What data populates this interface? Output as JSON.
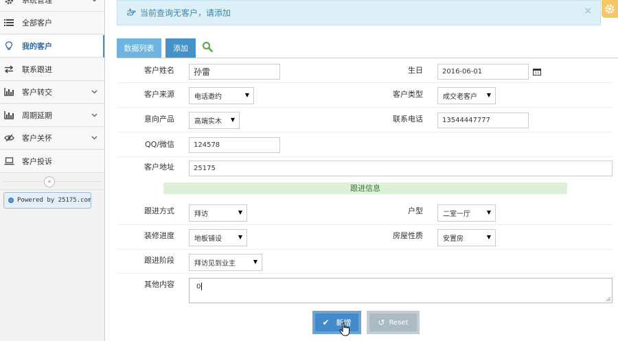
{
  "sidebar": {
    "items": [
      {
        "label": "系统管理",
        "icon": "gear-icon",
        "has_chevron": true
      },
      {
        "label": "全部客户",
        "icon": "list-icon",
        "has_chevron": false
      },
      {
        "label": "我的客户",
        "icon": "lightbulb-icon",
        "has_chevron": false,
        "active": true
      },
      {
        "label": "联系跟进",
        "icon": "exchange-icon",
        "has_chevron": false
      },
      {
        "label": "客户转交",
        "icon": "bar-chart-icon",
        "has_chevron": true
      },
      {
        "label": "周期延期",
        "icon": "bar-chart-icon",
        "has_chevron": true
      },
      {
        "label": "客户关怀",
        "icon": "eye-slash-icon",
        "has_chevron": true
      },
      {
        "label": "客户投诉",
        "icon": "laptop-icon",
        "has_chevron": false
      }
    ],
    "collapse_glyph": "«",
    "powered_by": "Powered by 25175.com"
  },
  "alert": {
    "text": "当前查询无客户，请添加",
    "close": "×"
  },
  "tabs": {
    "list_label": "数据列表",
    "add_label": "添加"
  },
  "form": {
    "name_label": "客户姓名",
    "name_value": "孙雷",
    "birthday_label": "生日",
    "birthday_value": "2016-06-01",
    "source_label": "客户来源",
    "source_value": "电话邀约",
    "type_label": "客户类型",
    "type_value": "成交老客户",
    "product_label": "意向产品",
    "product_value": "高端实木",
    "phone_label": "联系电话",
    "phone_value": "13544447777",
    "qq_label": "QQ/微信",
    "qq_value": "124578",
    "address_label": "客户地址",
    "address_value": "25175",
    "section_title": "跟进信息",
    "method_label": "跟进方式",
    "method_value": "拜访",
    "house_type_label": "户型",
    "house_type_value": "二室一厅",
    "progress_label": "装修进度",
    "progress_value": "地板铺设",
    "property_label": "房屋性质",
    "property_value": "安置房",
    "stage_label": "跟进阶段",
    "stage_value": "拜访见到业主",
    "other_label": "其他内容",
    "other_value": "0"
  },
  "buttons": {
    "submit_label": "新增",
    "reset_label": "Reset"
  },
  "colors": {
    "primary": "#428bca",
    "tab_light": "#6fb3e0",
    "alert_bg": "#def0f7",
    "alert_text": "#3a87ad",
    "band_bg": "#dff0d8",
    "band_text": "#3c763d",
    "settings_tab": "#f4c869",
    "reset_bg": "#abbac3"
  }
}
